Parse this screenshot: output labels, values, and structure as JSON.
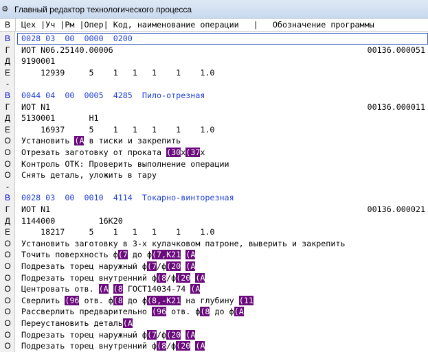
{
  "window": {
    "title": "Главный редактор технологического процесса",
    "icon": "gear-icon"
  },
  "header": {
    "mark": "В",
    "columns": "Цех |Уч |Рм |Опер| Код, наименование операции   |   Обозначение программы"
  },
  "colors": {
    "highlight": "#6a0a7c",
    "operation_text": "#1f3fd9"
  },
  "lines": [
    {
      "m": "В",
      "t": "0028 03  00  0000  0200",
      "r": "",
      "type": "cur"
    },
    {
      "m": "Г",
      "t": "ИОТ N06.25140.00006",
      "r": "00136.000051"
    },
    {
      "m": "Д",
      "t": "9190001",
      "r": ""
    },
    {
      "m": "Е",
      "t": "    12939     5    1   1   1    1    1.0",
      "r": ""
    },
    {
      "m": "-",
      "t": "",
      "r": ""
    },
    {
      "m": "В",
      "t": "0044 04  00  0005  4285  Пило-отрезная",
      "r": "",
      "type": "blue"
    },
    {
      "m": "Г",
      "t": "ИОТ N1",
      "r": "00136.000011"
    },
    {
      "m": "Д",
      "t": "5130001       Н1",
      "r": ""
    },
    {
      "m": "Е",
      "t": "    16937     5    1   1   1    1    1.0",
      "r": ""
    },
    {
      "m": "О",
      "segs": [
        {
          "t": "Установить "
        },
        {
          "t": "(А",
          "h": true
        },
        {
          "t": " в тиски и закрепить"
        }
      ]
    },
    {
      "m": "О",
      "segs": [
        {
          "t": "Отрезать заготовку от проката "
        },
        {
          "t": "(30",
          "h": true
        },
        {
          "t": "x"
        },
        {
          "t": "(37",
          "h": true
        },
        {
          "t": "x"
        }
      ]
    },
    {
      "m": "О",
      "t": "Контроль ОТК: Проверить выполнение операции",
      "r": ""
    },
    {
      "m": "О",
      "t": "Снять деталь, уложить в тару",
      "r": ""
    },
    {
      "m": "-",
      "t": "",
      "r": ""
    },
    {
      "m": "В",
      "t": "0028 03  00  0010  4114  Токарно-винторезная",
      "r": "",
      "type": "blue"
    },
    {
      "m": "Г",
      "t": "ИОТ N1",
      "r": "00136.000021"
    },
    {
      "m": "Д",
      "t": "1144000         16К20",
      "r": ""
    },
    {
      "m": "Е",
      "t": "    18217     5    1   1   1    1    1.0",
      "r": ""
    },
    {
      "m": "О",
      "t": "Установить заготовку в 3-х кулачковом патроне, выверить и закрепить",
      "r": ""
    },
    {
      "m": "О",
      "segs": [
        {
          "t": "Точить поверхность ф"
        },
        {
          "t": "(7",
          "h": true
        },
        {
          "t": " до ф"
        },
        {
          "t": "(7,K21",
          "h": true
        },
        {
          "t": " "
        },
        {
          "t": "(А",
          "h": true
        }
      ]
    },
    {
      "m": "О",
      "segs": [
        {
          "t": "Подрезать торец наружный ф"
        },
        {
          "t": "(7",
          "h": true
        },
        {
          "t": "/ф"
        },
        {
          "t": "(20",
          "h": true
        },
        {
          "t": " "
        },
        {
          "t": "(А",
          "h": true
        }
      ]
    },
    {
      "m": "О",
      "segs": [
        {
          "t": "Подрезать торец внутренний ф"
        },
        {
          "t": "(8",
          "h": true
        },
        {
          "t": "/ф"
        },
        {
          "t": "(20",
          "h": true
        },
        {
          "t": " "
        },
        {
          "t": "(А",
          "h": true
        }
      ]
    },
    {
      "m": "О",
      "segs": [
        {
          "t": "Центровать отв. "
        },
        {
          "t": "(А",
          "h": true
        },
        {
          "t": " "
        },
        {
          "t": "(8",
          "h": true
        },
        {
          "t": " ГОСТ14034-74 "
        },
        {
          "t": "(А",
          "h": true
        }
      ]
    },
    {
      "m": "О",
      "segs": [
        {
          "t": "Сверлить "
        },
        {
          "t": "(96",
          "h": true
        },
        {
          "t": " отв. ф"
        },
        {
          "t": "(8",
          "h": true
        },
        {
          "t": " до ф"
        },
        {
          "t": "(8,-K21",
          "h": true
        },
        {
          "t": " на глубину "
        },
        {
          "t": "(11",
          "h": true
        }
      ]
    },
    {
      "m": "О",
      "segs": [
        {
          "t": "Рассверлить предварительно "
        },
        {
          "t": "(96",
          "h": true
        },
        {
          "t": " отв. ф"
        },
        {
          "t": "(8",
          "h": true
        },
        {
          "t": " до ф"
        },
        {
          "t": "(А",
          "h": true
        }
      ]
    },
    {
      "m": "О",
      "segs": [
        {
          "t": "Переустановить деталь"
        },
        {
          "t": "(А",
          "h": true
        }
      ]
    },
    {
      "m": "О",
      "segs": [
        {
          "t": "Подрезать торец наружный ф"
        },
        {
          "t": "(7",
          "h": true
        },
        {
          "t": "/ф"
        },
        {
          "t": "(20",
          "h": true
        },
        {
          "t": " "
        },
        {
          "t": "(А",
          "h": true
        }
      ]
    },
    {
      "m": "О",
      "segs": [
        {
          "t": "Подрезать торец внутренний ф"
        },
        {
          "t": "(8",
          "h": true
        },
        {
          "t": "/ф"
        },
        {
          "t": "(20",
          "h": true
        },
        {
          "t": " "
        },
        {
          "t": "(А",
          "h": true
        }
      ]
    }
  ]
}
